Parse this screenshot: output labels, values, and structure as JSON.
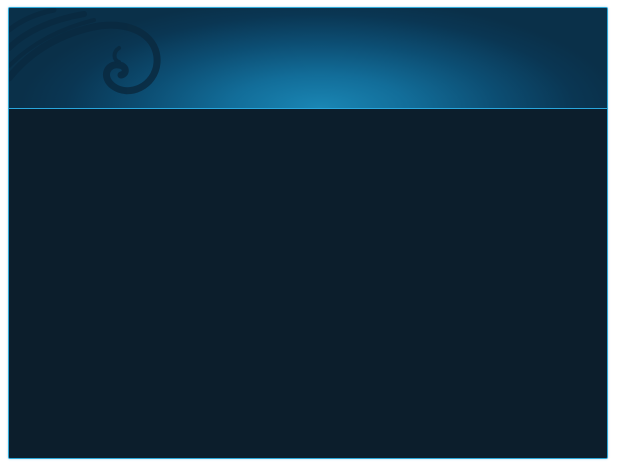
{
  "window": {
    "title": ""
  },
  "header": {
    "decoration_icon": "swirl-ornament-icon",
    "colors": {
      "glow": "#1a86b4",
      "edge": "#0a3049",
      "divider": "#29a6dc"
    }
  },
  "content": {
    "background": "#0c1e2c",
    "text": ""
  },
  "frame": {
    "border_color": "#2fa8d8"
  }
}
